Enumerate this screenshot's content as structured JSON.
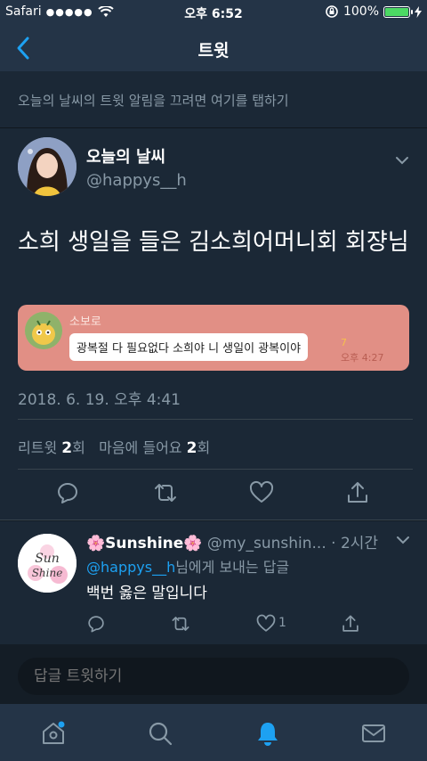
{
  "status_bar": {
    "carrier": "Safari",
    "signal_dots": "●●●●●",
    "time": "오후 6:52",
    "battery": "100%",
    "battery_level": 1.0
  },
  "nav": {
    "back_icon": "chevron-left-icon",
    "title": "트윗"
  },
  "banner": {
    "text": "오늘의 날씨의 트윗 알림을 끄려면 여기를 탭하기"
  },
  "tweet": {
    "author_name": "오늘의 날씨",
    "author_handle": "@happys__h",
    "text": "소희 생일을 들은 김소희어머니회 회쟝님",
    "media": {
      "sender": "소보로",
      "message": "광복절 다 필요없다 소희야 니 생일이 광복이야",
      "read_count": "7",
      "time": "오후 4:27"
    },
    "timestamp": "2018. 6. 19. 오후 4:41",
    "stats": {
      "retweet_label": "리트윗",
      "retweet_count": "2",
      "retweet_unit": "회",
      "like_label": "마음에 들어요",
      "like_count": "2",
      "like_unit": "회"
    }
  },
  "reply": {
    "name": "🌸Sunshine🌸",
    "handle": "@my_sunshin...",
    "age": "· 2시간",
    "to_handle": "@happys__h",
    "to_suffix": "님에게 보내는 답글",
    "text": "백번 옳은 말입니다",
    "like_count": "1",
    "avatar_text_top": "Sun",
    "avatar_text_bottom": "Shine"
  },
  "composer": {
    "placeholder": "답글 트윗하기"
  },
  "colors": {
    "accent": "#1da1f2",
    "background": "#141d26",
    "card": "#1b2836",
    "bar": "#243447",
    "muted": "#8899a6"
  },
  "tabbar": {
    "items": [
      "home-icon",
      "search-icon",
      "notifications-icon",
      "messages-icon"
    ],
    "active": "notifications-icon"
  }
}
